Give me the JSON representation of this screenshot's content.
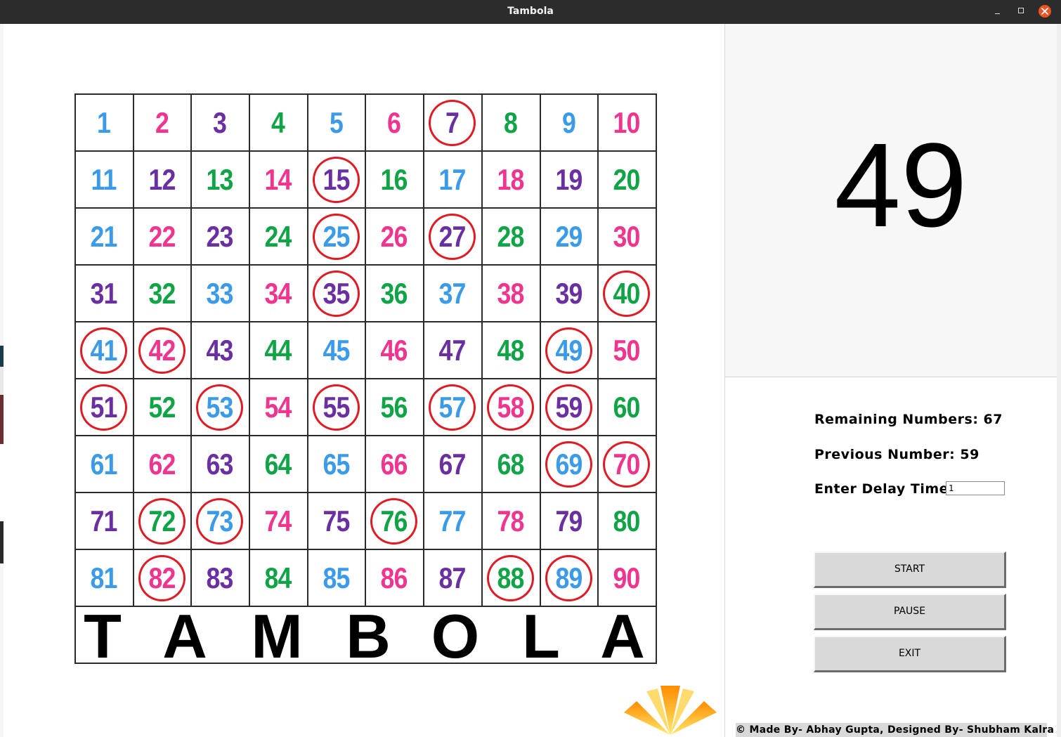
{
  "window": {
    "title": "Tambola"
  },
  "colors": {
    "blue": "#3b9be8",
    "pink": "#f0358e",
    "purple": "#6a2fa0",
    "green": "#10a447",
    "ring": "#e01b24"
  },
  "board": {
    "numbers": [
      1,
      2,
      3,
      4,
      5,
      6,
      7,
      8,
      9,
      10,
      11,
      12,
      13,
      14,
      15,
      16,
      17,
      18,
      19,
      20,
      21,
      22,
      23,
      24,
      25,
      26,
      27,
      28,
      29,
      30,
      31,
      32,
      33,
      34,
      35,
      36,
      37,
      38,
      39,
      40,
      41,
      42,
      43,
      44,
      45,
      46,
      47,
      48,
      49,
      50,
      51,
      52,
      53,
      54,
      55,
      56,
      57,
      58,
      59,
      60,
      61,
      62,
      63,
      64,
      65,
      66,
      67,
      68,
      69,
      70,
      71,
      72,
      73,
      74,
      75,
      76,
      77,
      78,
      79,
      80,
      81,
      82,
      83,
      84,
      85,
      86,
      87,
      88,
      89,
      90
    ],
    "number_colors": [
      "blue",
      "pink",
      "purple",
      "green",
      "blue",
      "pink",
      "purple",
      "green",
      "blue",
      "pink",
      "blue",
      "purple",
      "green",
      "pink",
      "purple",
      "green",
      "blue",
      "pink",
      "purple",
      "green",
      "blue",
      "pink",
      "purple",
      "green",
      "blue",
      "pink",
      "purple",
      "green",
      "blue",
      "pink",
      "purple",
      "green",
      "blue",
      "pink",
      "purple",
      "green",
      "blue",
      "pink",
      "purple",
      "green",
      "blue",
      "pink",
      "purple",
      "green",
      "blue",
      "pink",
      "purple",
      "green",
      "blue",
      "pink",
      "purple",
      "green",
      "blue",
      "pink",
      "purple",
      "green",
      "blue",
      "pink",
      "purple",
      "green",
      "blue",
      "pink",
      "purple",
      "green",
      "blue",
      "pink",
      "purple",
      "green",
      "blue",
      "pink",
      "purple",
      "green",
      "blue",
      "pink",
      "purple",
      "green",
      "blue",
      "pink",
      "purple",
      "green",
      "blue",
      "pink",
      "purple",
      "green",
      "blue",
      "pink",
      "purple",
      "green",
      "blue",
      "pink"
    ],
    "called": [
      7,
      15,
      25,
      27,
      35,
      40,
      41,
      42,
      49,
      51,
      53,
      55,
      57,
      58,
      59,
      69,
      70,
      72,
      73,
      76,
      82,
      88,
      89
    ],
    "banner": [
      "T",
      "A",
      "M",
      "B",
      "O",
      "L",
      "A"
    ]
  },
  "panel": {
    "current_number": "49",
    "remaining_label": "Remaining Numbers: 67",
    "previous_label": "Previous Number: 59",
    "delay_label": "Enter Delay Time:",
    "delay_value": "1",
    "start_label": "START",
    "pause_label": "PAUSE",
    "exit_label": "EXIT",
    "credit": "© Made By- Abhay Gupta, Designed By- Shubham Kalra ©"
  }
}
